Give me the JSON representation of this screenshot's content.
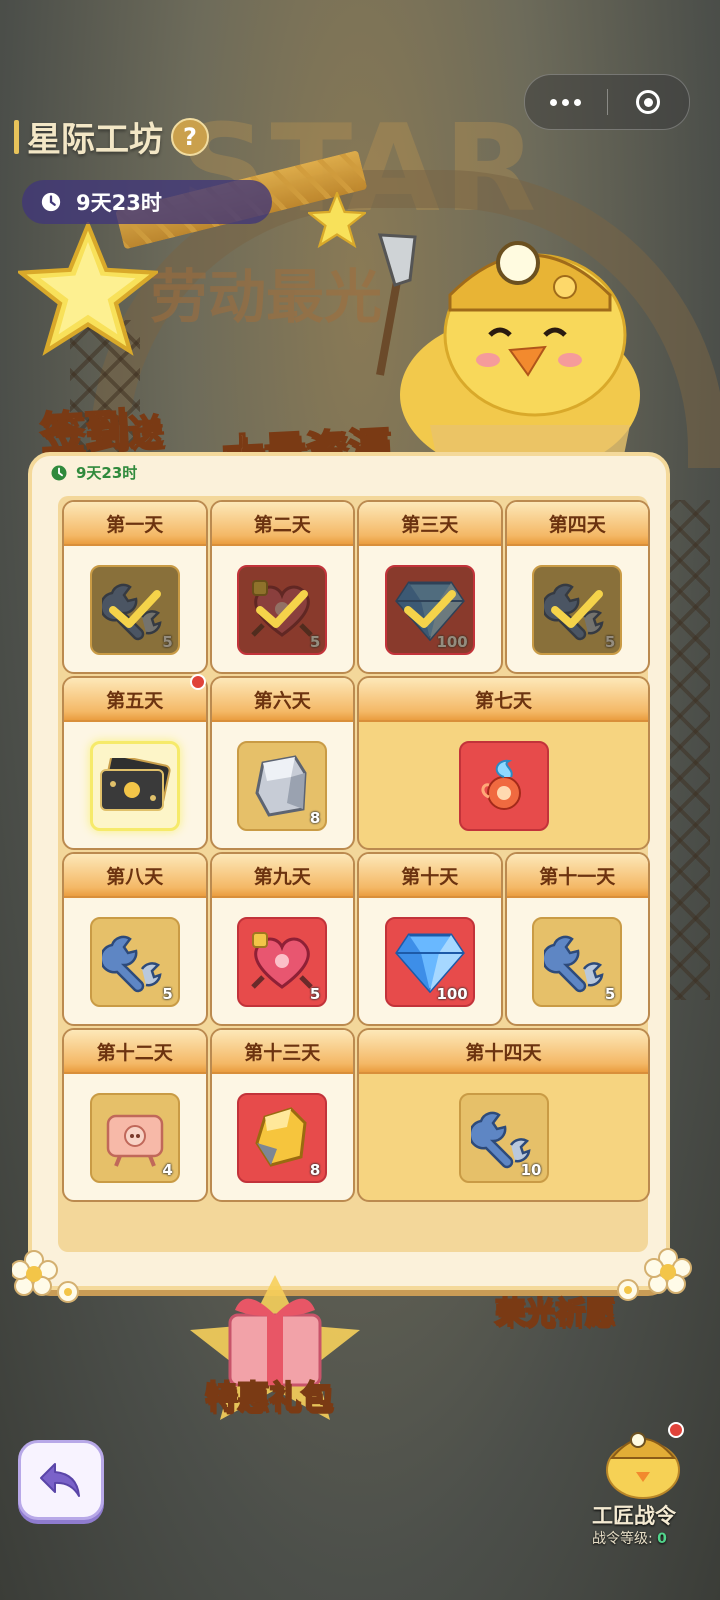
{
  "header": {
    "title": "星际工坊",
    "help_icon": "question-icon",
    "event_timer": "9天23时"
  },
  "capsule": {
    "more_icon": "more-dots-icon",
    "close_icon": "target-close-icon"
  },
  "banner": {
    "line1_a": "签到",
    "line1_b": "送",
    "line2": "大量资源"
  },
  "panel": {
    "timer": "9天23时",
    "days": [
      {
        "label": "第一天",
        "item": "wrench",
        "qty": "5",
        "claimed": true
      },
      {
        "label": "第二天",
        "item": "heart-puzzle",
        "qty": "5",
        "claimed": true
      },
      {
        "label": "第三天",
        "item": "diamond",
        "qty": "100",
        "claimed": true
      },
      {
        "label": "第四天",
        "item": "wrench",
        "qty": "5",
        "claimed": true
      },
      {
        "label": "第五天",
        "item": "card",
        "qty": "",
        "claimed": false,
        "active": true
      },
      {
        "label": "第六天",
        "item": "stone",
        "qty": "8",
        "claimed": false
      },
      {
        "label": "第七天",
        "item": "fire-orb",
        "qty": "",
        "claimed": false
      },
      {
        "label": "第八天",
        "item": "wrench",
        "qty": "5",
        "claimed": false
      },
      {
        "label": "第九天",
        "item": "heart-puzzle",
        "qty": "5",
        "claimed": false
      },
      {
        "label": "第十天",
        "item": "diamond",
        "qty": "100",
        "claimed": false
      },
      {
        "label": "第十一天",
        "item": "wrench",
        "qty": "5",
        "claimed": false
      },
      {
        "label": "第十二天",
        "item": "pig-ticket",
        "qty": "4",
        "claimed": false
      },
      {
        "label": "第十三天",
        "item": "gold-ore",
        "qty": "8",
        "claimed": false
      },
      {
        "label": "第十四天",
        "item": "wrench",
        "qty": "10",
        "claimed": false
      }
    ]
  },
  "bottom": {
    "gift_label": "特惠礼包",
    "glory_label": "荣光祈愿",
    "pass_title": "工匠战令",
    "pass_level_label": "战令等级:",
    "pass_level_value": "0",
    "back_icon": "back-arrow-icon"
  },
  "colors": {
    "accent_gold": "#f4b866",
    "claimed_check": "#f5d34a",
    "timer_green": "#2f8a3c"
  }
}
